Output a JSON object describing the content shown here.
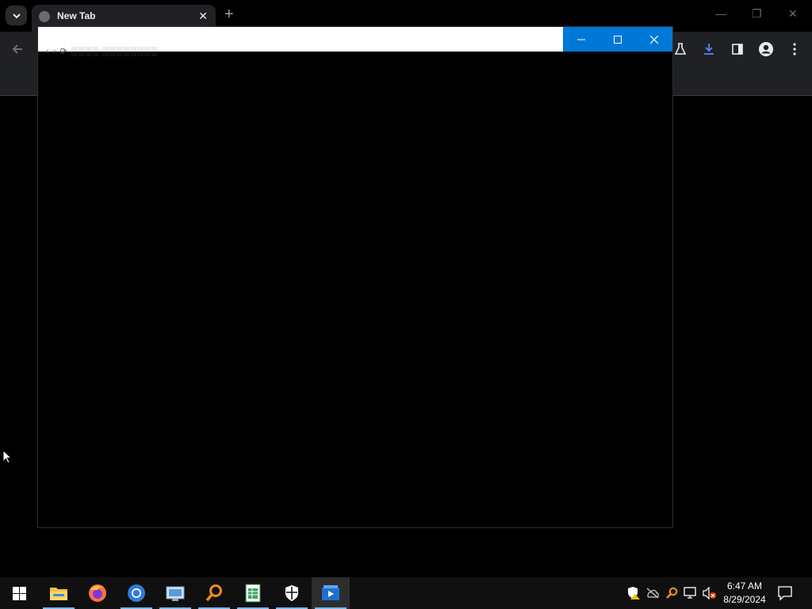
{
  "browser": {
    "tab_title": "New Tab",
    "tab_close_glyph": "✕",
    "new_tab_glyph": "+",
    "window_controls": {
      "minimize": "—",
      "restore": "❐",
      "close": "✕"
    },
    "toolbar_icons": [
      "labs-flask-icon",
      "download-icon",
      "side-panel-icon",
      "profile-icon",
      "menu-kebab-icon"
    ]
  },
  "overlay": {
    "title": "",
    "controls": {
      "minimize": "—",
      "maximize": "☐",
      "close": "✕"
    },
    "ghost_text": "‹  ›  ⟳   ░░░░ ░░░░░░░░"
  },
  "taskbar": {
    "apps": [
      "file-explorer",
      "firefox",
      "chromium",
      "control-panel",
      "search-tool",
      "spreadsheet",
      "security-shield",
      "media-player"
    ],
    "active_app": "media-player",
    "clock": {
      "time": "6:47 AM",
      "date": "8/29/2024"
    },
    "colors": {
      "accent": "#0078d7",
      "underline": "#76b9ed"
    }
  }
}
